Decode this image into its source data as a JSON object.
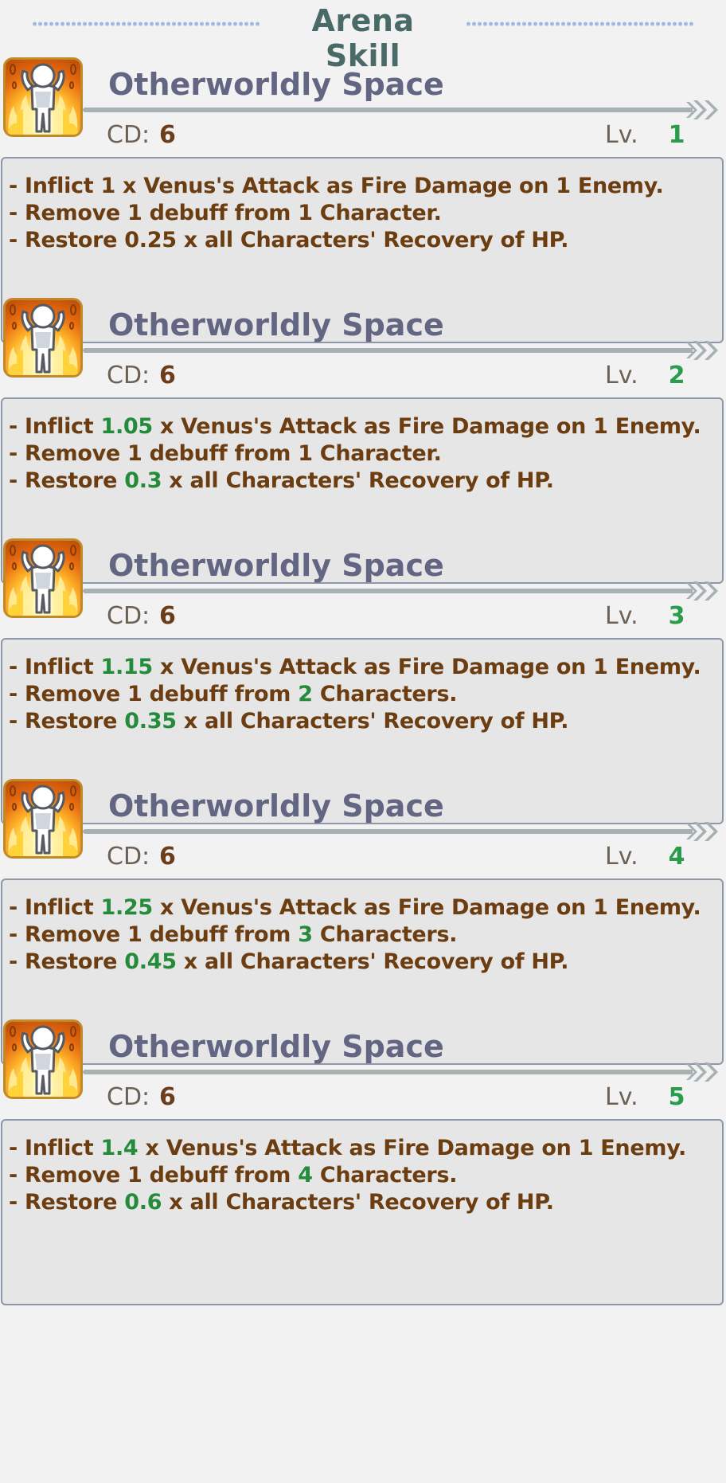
{
  "header": {
    "title": "Arena Skill"
  },
  "colors": {
    "text_brown": "#6c3d10",
    "highlight_green": "#238b3a",
    "title_gray": "#636683",
    "box_bg": "#e6e6e6"
  },
  "cards": [
    {
      "icon": "fire-figure-skill-icon",
      "name": "Otherworldly Space",
      "cd_label": "CD:",
      "cd_value": "6",
      "lv_label": "Lv.",
      "lv_value": "1",
      "lines": [
        [
          "- Inflict 1 x Venus's Attack as Fire Damage on 1 Enemy."
        ],
        [
          "- Remove 1 debuff from 1 Character."
        ],
        [
          "- Restore 0.25 x all Characters' Recovery of HP."
        ]
      ]
    },
    {
      "icon": "fire-figure-skill-icon",
      "name": "Otherworldly Space",
      "cd_label": "CD:",
      "cd_value": "6",
      "lv_label": "Lv.",
      "lv_value": "2",
      "lines": [
        [
          "- Inflict ",
          "1.05",
          " x Venus's Attack as Fire Damage on 1 Enemy."
        ],
        [
          "- Remove 1 debuff from 1 Character."
        ],
        [
          "- Restore ",
          "0.3",
          " x all Characters' Recovery of HP."
        ]
      ]
    },
    {
      "icon": "fire-figure-skill-icon",
      "name": "Otherworldly Space",
      "cd_label": "CD:",
      "cd_value": "6",
      "lv_label": "Lv.",
      "lv_value": "3",
      "lines": [
        [
          "- Inflict ",
          "1.15",
          " x Venus's Attack as Fire Damage on 1 Enemy."
        ],
        [
          "- Remove 1 debuff from ",
          "2",
          " Characters."
        ],
        [
          "- Restore ",
          "0.35",
          " x all Characters' Recovery of HP."
        ]
      ]
    },
    {
      "icon": "fire-figure-skill-icon",
      "name": "Otherworldly Space",
      "cd_label": "CD:",
      "cd_value": "6",
      "lv_label": "Lv.",
      "lv_value": "4",
      "lines": [
        [
          "- Inflict ",
          "1.25",
          " x Venus's Attack as Fire Damage on 1 Enemy."
        ],
        [
          "- Remove 1 debuff from ",
          "3",
          " Characters."
        ],
        [
          "- Restore ",
          "0.45",
          " x all Characters' Recovery of HP."
        ]
      ]
    },
    {
      "icon": "fire-figure-skill-icon",
      "name": "Otherworldly Space",
      "cd_label": "CD:",
      "cd_value": "6",
      "lv_label": "Lv.",
      "lv_value": "5",
      "lines": [
        [
          "- Inflict ",
          "1.4",
          " x Venus's Attack as Fire Damage on 1 Enemy."
        ],
        [
          "- Remove 1 debuff from ",
          "4",
          " Characters."
        ],
        [
          "- Restore ",
          "0.6",
          " x all Characters' Recovery of HP."
        ]
      ]
    }
  ]
}
